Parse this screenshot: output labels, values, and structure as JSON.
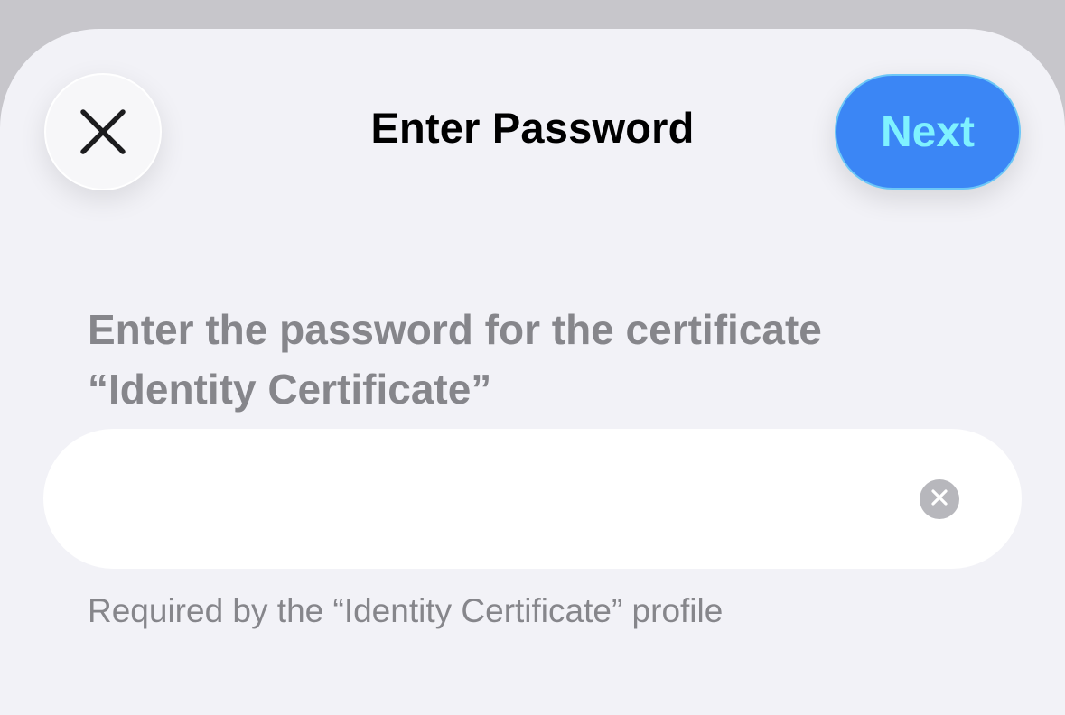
{
  "nav": {
    "title": "Enter Password",
    "close_icon": "close-icon",
    "next_label": "Next"
  },
  "prompt": {
    "line1": "Enter the password for the certificate",
    "line2": "“Identity Certificate”"
  },
  "password_field": {
    "value": "",
    "placeholder": "",
    "clear_icon": "clear-icon"
  },
  "footnote": "Required by the “Identity Certificate” profile",
  "colors": {
    "accent": "#3b86f5",
    "next_text": "#7ff2ff",
    "background": "#f2f2f7",
    "secondary_text": "#86868b"
  }
}
